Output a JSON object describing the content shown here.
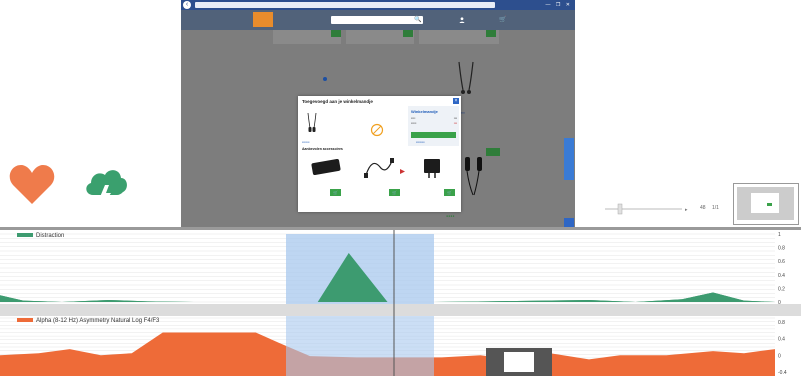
{
  "colors": {
    "distraction": "#3d9b70",
    "alpha": "#ee6b38",
    "selection": "#a8c8ee",
    "brand_orange": "#e88c2c",
    "site_header": "#51627a",
    "add_green": "#3aa24a",
    "link_blue": "#1e5bb8"
  },
  "browser": {
    "address": "",
    "window_buttons": "—  ❐  ✕"
  },
  "site": {
    "logo_text": "",
    "logo_tagline": "",
    "search_placeholder": "",
    "search_icon": "🔍",
    "cart_icon": "🛒",
    "promo_text": "",
    "sidebar_tab": ""
  },
  "modal": {
    "title": "Toegevoegd aan je winkelmandje",
    "close": "×",
    "product_name": "",
    "product_price": "",
    "summary_title": "Winkelmandje",
    "checkout_label": "",
    "accessories_title": "Aanbevolen accessoires",
    "accessories": [
      {
        "name": "",
        "price": "",
        "stock": "",
        "link": ""
      },
      {
        "name": "",
        "price": "",
        "stock": "",
        "link": ""
      },
      {
        "name": "",
        "price": "",
        "stock": "",
        "link": ""
      }
    ],
    "add_symbol": "🛒"
  },
  "player": {
    "label_a": "48",
    "label_b": "1/1"
  },
  "thumbnail": {
    "tag": ""
  },
  "chart_data": [
    {
      "type": "area",
      "series": [
        {
          "name": "Distraction"
        }
      ],
      "x": [
        0,
        6,
        12,
        18,
        24,
        30,
        36,
        42,
        48,
        54,
        60,
        66,
        72,
        78,
        84,
        90,
        96,
        100
      ],
      "y": [
        0.1,
        0.02,
        0.05,
        0.0,
        0.0,
        0.0,
        0.0,
        0.0,
        0.0,
        0.0,
        0.0,
        0.0,
        0.0,
        0.0,
        0.0,
        0.0,
        0.0,
        0.0
      ],
      "points": [
        [
          0,
          0.1
        ],
        [
          3,
          0.02
        ],
        [
          8,
          0.0
        ],
        [
          14,
          0.03
        ],
        [
          19,
          0.01
        ],
        [
          25,
          0.0
        ],
        [
          34,
          0.0
        ],
        [
          41,
          0.0
        ],
        [
          45,
          0.72
        ],
        [
          50,
          0.0
        ],
        [
          56,
          0.0
        ],
        [
          63,
          0.01
        ],
        [
          70,
          0.02
        ],
        [
          76,
          0.03
        ],
        [
          82,
          0.0
        ],
        [
          88,
          0.04
        ],
        [
          92,
          0.14
        ],
        [
          96,
          0.02
        ],
        [
          100,
          0.0
        ]
      ],
      "ylim": [
        0,
        1
      ],
      "yticks": [
        "1",
        "0.8",
        "0.6",
        "0.4",
        "0.2",
        "0"
      ],
      "grid": true
    },
    {
      "type": "area",
      "series": [
        {
          "name": "Alpha (8-12 Hz) Asymmetry Natural Log F4/F3"
        }
      ],
      "points": [
        [
          0,
          0.0
        ],
        [
          5,
          0.05
        ],
        [
          9,
          0.15
        ],
        [
          13,
          0.0
        ],
        [
          17,
          0.05
        ],
        [
          21,
          0.55
        ],
        [
          26,
          0.55
        ],
        [
          33,
          0.55
        ],
        [
          36,
          0.3
        ],
        [
          40,
          -0.02
        ],
        [
          46,
          -0.05
        ],
        [
          52,
          -0.05
        ],
        [
          57,
          -0.05
        ],
        [
          62,
          0.0
        ],
        [
          66,
          -0.1
        ],
        [
          71,
          0.05
        ],
        [
          76,
          -0.1
        ],
        [
          80,
          0.0
        ],
        [
          86,
          0.0
        ],
        [
          92,
          0.1
        ],
        [
          96,
          0.05
        ],
        [
          100,
          0.15
        ]
      ],
      "ylim": [
        -0.5,
        0.9
      ],
      "yticks": [
        "0.8",
        "0.4",
        "0",
        "-0.4"
      ],
      "grid": true
    }
  ]
}
